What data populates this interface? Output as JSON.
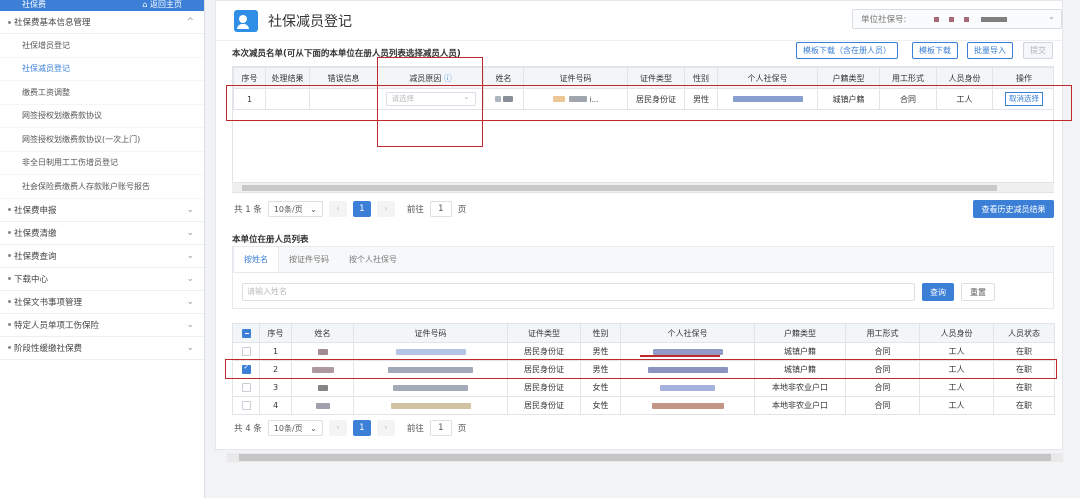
{
  "sidebar": {
    "top": "社保费",
    "back": "返回主页",
    "groups": [
      {
        "label": "社保费基本信息管理",
        "chev": "^"
      }
    ],
    "items": [
      "社保增员登记",
      "社保减员登记",
      "缴费工资调整",
      "网签授权划缴费款协议",
      "网签授权划缴费款协议(一次上门)",
      "非全日制用工工伤增员登记",
      "社会保险费缴费人存款账户账号报告"
    ],
    "groups2": [
      "社保费申报",
      "社保费清缴",
      "社保费查询",
      "下载中心",
      "社保文书事项管理",
      "特定人员单项工伤保险",
      "阶段性缓缴社保费"
    ]
  },
  "header": {
    "title": "社保减员登记",
    "unit_label": "单位社保号:"
  },
  "list1": {
    "title": "本次减员名单(可从下面的本单位在册人员列表选择减员人员)",
    "buttons": [
      "模板下载（含在册人员）",
      "模板下载",
      "批量导入",
      "提交"
    ],
    "columns": [
      "序号",
      "处理结果",
      "错误信息",
      "减员原因",
      "姓名",
      "证件号码",
      "证件类型",
      "性别",
      "个人社保号",
      "户籍类型",
      "用工形式",
      "人员身份",
      "操作"
    ],
    "row": {
      "seq": "1",
      "reason_placeholder": "请选择",
      "id_suffix": "i...",
      "id_type": "居民身份证",
      "gender": "男性",
      "hukou": "城镇户籍",
      "employment": "合同",
      "identity": "工人",
      "action": "取消选择"
    },
    "pager": {
      "total": "共 1 条",
      "size": "10条/页",
      "page": "1",
      "goto": "前往",
      "goto_val": "1",
      "page_unit": "页"
    },
    "history_button": "查看历史减员结果"
  },
  "list2": {
    "title": "本单位在册人员列表",
    "tabs": [
      "按姓名",
      "按证件号码",
      "按个人社保号"
    ],
    "search_placeholder": "请输入姓名",
    "query": "查询",
    "reset": "重置",
    "columns": [
      "序号",
      "姓名",
      "证件号码",
      "证件类型",
      "性别",
      "个人社保号",
      "户籍类型",
      "用工形式",
      "人员身份",
      "人员状态"
    ],
    "rows": [
      {
        "seq": "1",
        "id_type": "居民身份证",
        "gender": "男性",
        "hukou": "城镇户籍",
        "employment": "合同",
        "identity": "工人",
        "status": "在职",
        "checked": false
      },
      {
        "seq": "2",
        "id_type": "居民身份证",
        "gender": "男性",
        "hukou": "城镇户籍",
        "employment": "合同",
        "identity": "工人",
        "status": "在职",
        "checked": true
      },
      {
        "seq": "3",
        "id_type": "居民身份证",
        "gender": "女性",
        "hukou": "本地非农业户口",
        "employment": "合同",
        "identity": "工人",
        "status": "在职",
        "checked": false
      },
      {
        "seq": "4",
        "id_type": "居民身份证",
        "gender": "女性",
        "hukou": "本地非农业户口",
        "employment": "合同",
        "identity": "工人",
        "status": "在职",
        "checked": false
      }
    ],
    "pager": {
      "total": "共 4 条",
      "size": "10条/页",
      "page": "1",
      "goto": "前往",
      "goto_val": "1",
      "page_unit": "页"
    }
  },
  "colors": {
    "accent": "#3b7fd7",
    "highlight": "#c0282c"
  }
}
